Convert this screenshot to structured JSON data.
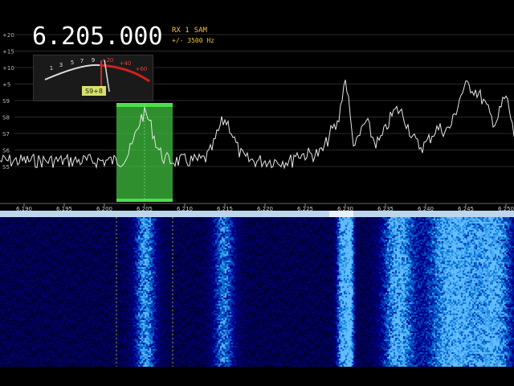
{
  "frequency_display": "6.205.000",
  "receiver": {
    "rx_label": "RX 1",
    "mode": "SAM",
    "bandwidth": "+/- 3500 Hz"
  },
  "smeter": {
    "scale_labels": [
      "1",
      "3",
      "5",
      "7",
      "9",
      "+20",
      "+40",
      "+60"
    ],
    "reading": "S9+8",
    "level_fraction": 0.57
  },
  "level_scale": [
    "+20",
    "+15",
    "+10",
    "+5",
    "S9",
    "S8",
    "S7",
    "S6",
    "S5"
  ],
  "frequency_axis": {
    "ticks": [
      "6.190",
      "6.195",
      "6.200",
      "6.205",
      "6.210",
      "6.215",
      "6.220",
      "6.225",
      "6.230",
      "6.235",
      "6.240",
      "6.245",
      "6.250"
    ],
    "start_mhz": 6.187,
    "end_mhz": 6.251
  },
  "filter_passband": {
    "low_mhz": 6.2015,
    "high_mhz": 6.2085,
    "color": "#3fbf3f"
  },
  "colors": {
    "trace": "#e6e6e6",
    "accent": "#f2c23a",
    "waterfall_bg": "#02041a",
    "divider": "#bcd6f0"
  }
}
